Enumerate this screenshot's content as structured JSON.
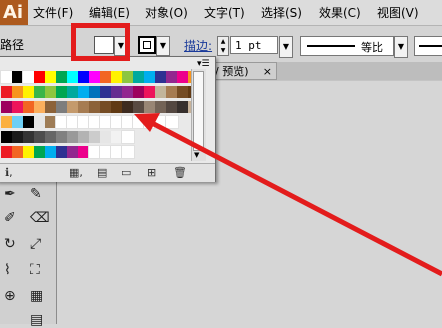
{
  "app": {
    "logo": "Ai"
  },
  "menu": [
    "文件(F)",
    "编辑(E)",
    "对象(O)",
    "文字(T)",
    "选择(S)",
    "效果(C)",
    "视图(V)"
  ],
  "control": {
    "path_label": "路径",
    "stroke_label": "描边:",
    "stroke_weight": "1 pt",
    "profile_label": "等比"
  },
  "document_tab": {
    "label": "/ 预览)",
    "close": "×"
  },
  "colors": {
    "highlight": "#e31c1c",
    "panel_bg": "#e9e9e9"
  },
  "swatches": {
    "row1": [
      "#ffffff",
      "#000000",
      "#ffffff",
      "#ff0000",
      "#ffff00",
      "#00a651",
      "#00ffff",
      "#0000ff",
      "#ff00ff",
      "#f26522",
      "#fff200",
      "#8dc63f",
      "#00a99d",
      "#00aeef",
      "#2e3192",
      "#92278f",
      "#ec008c",
      "#f7941d"
    ],
    "row2": [
      "#ed1c24",
      "#f7941d",
      "#fff200",
      "#39b54a",
      "#8dc63f",
      "#00a651",
      "#00a99d",
      "#00aeef",
      "#0072bc",
      "#2e3192",
      "#662d91",
      "#92278f",
      "#9e005d",
      "#ed145b",
      "#c2b59b",
      "#a67c52",
      "#754c24",
      "#603913"
    ],
    "row3": [
      "#9e005d",
      "#ed145b",
      "#f26522",
      "#fbaf5d",
      "#8c6239",
      "#7d7d7d",
      "#c49a6c",
      "#a67c52",
      "#8c6239",
      "#754c24",
      "#603913",
      "#3d2b1f",
      "#594a42",
      "#998675",
      "#736357",
      "#534741",
      "#362f2d",
      "#c7b299"
    ],
    "row4": [
      "#fbb040",
      "#6dcff6",
      "#000000",
      "#e6e6e6",
      "#9e7c56",
      "#ffffff",
      "#ffffff",
      "#ffffff",
      "#ffffff",
      "#ffffff",
      "#ffffff",
      "#ffffff",
      "#ffffff",
      "#ffffff",
      "#ffffff",
      "#ffffff"
    ],
    "row5": [
      "#000000",
      "#1a1a1a",
      "#333333",
      "#4d4d4d",
      "#666666",
      "#808080",
      "#999999",
      "#b3b3b3",
      "#cccccc",
      "#e6e6e6",
      "#f2f2f2",
      "#ffffff"
    ],
    "row6": [
      "#ed1c24",
      "#f26522",
      "#fff200",
      "#00a651",
      "#00aeef",
      "#2e3192",
      "#92278f",
      "#ec008c",
      "#ffffff",
      "#ffffff",
      "#ffffff",
      "#ffffff"
    ]
  }
}
